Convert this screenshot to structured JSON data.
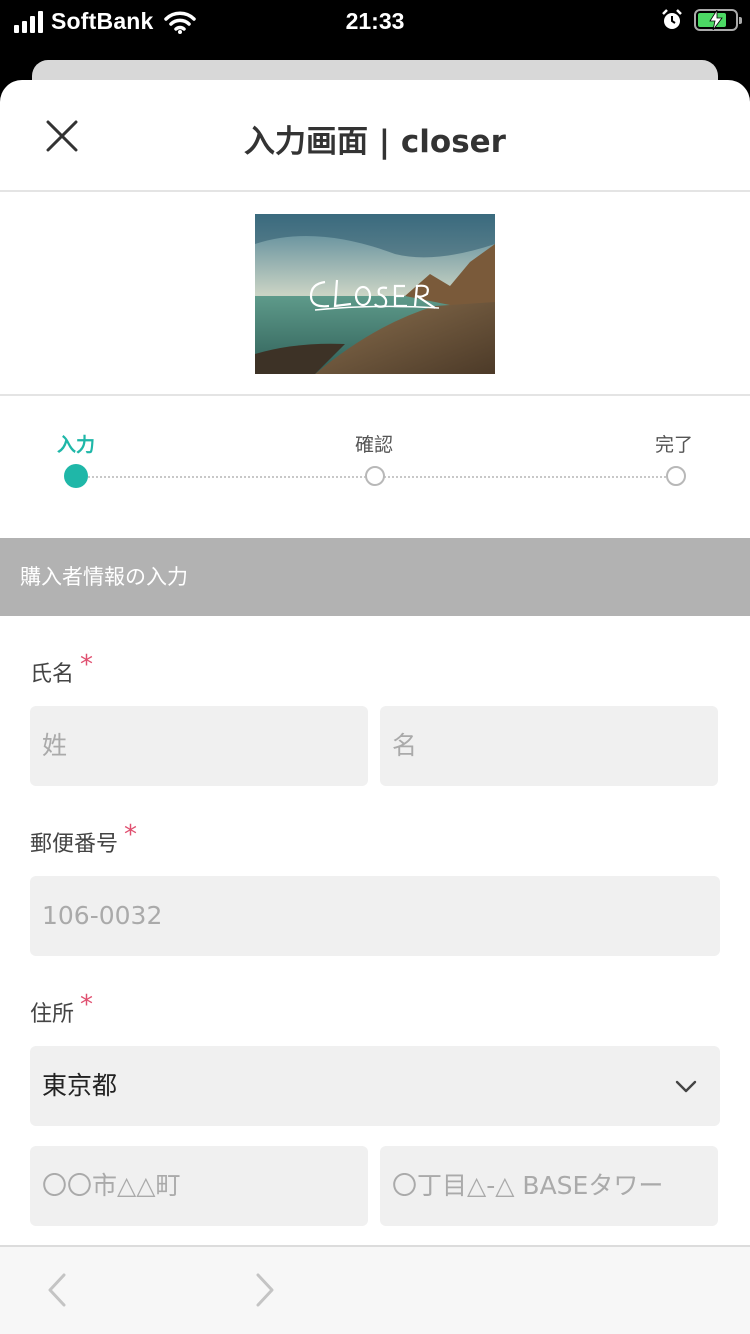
{
  "status_bar": {
    "carrier": "SoftBank",
    "time": "21:33",
    "battery_color": "#4cd964"
  },
  "header": {
    "title": "入力画面 | closer",
    "close_icon": "close-icon"
  },
  "banner": {
    "logo_text": "Closer"
  },
  "steps": [
    {
      "label": "入力",
      "active": true
    },
    {
      "label": "確認",
      "active": false
    },
    {
      "label": "完了",
      "active": false
    }
  ],
  "accent_color": "#1fb7a8",
  "section": {
    "title": "購入者情報の入力"
  },
  "form": {
    "name_label": "氏名",
    "last_name_placeholder": "姓",
    "first_name_placeholder": "名",
    "postal_label": "郵便番号",
    "postal_placeholder": "106-0032",
    "address_label": "住所",
    "prefecture_value": "東京都",
    "city_placeholder": "〇〇市△△町",
    "street_placeholder": "〇丁目△-△ BASEタワー",
    "required_mark": "*"
  },
  "bottom_nav": {
    "back_icon": "chevron-left-icon",
    "forward_icon": "chevron-right-icon"
  }
}
